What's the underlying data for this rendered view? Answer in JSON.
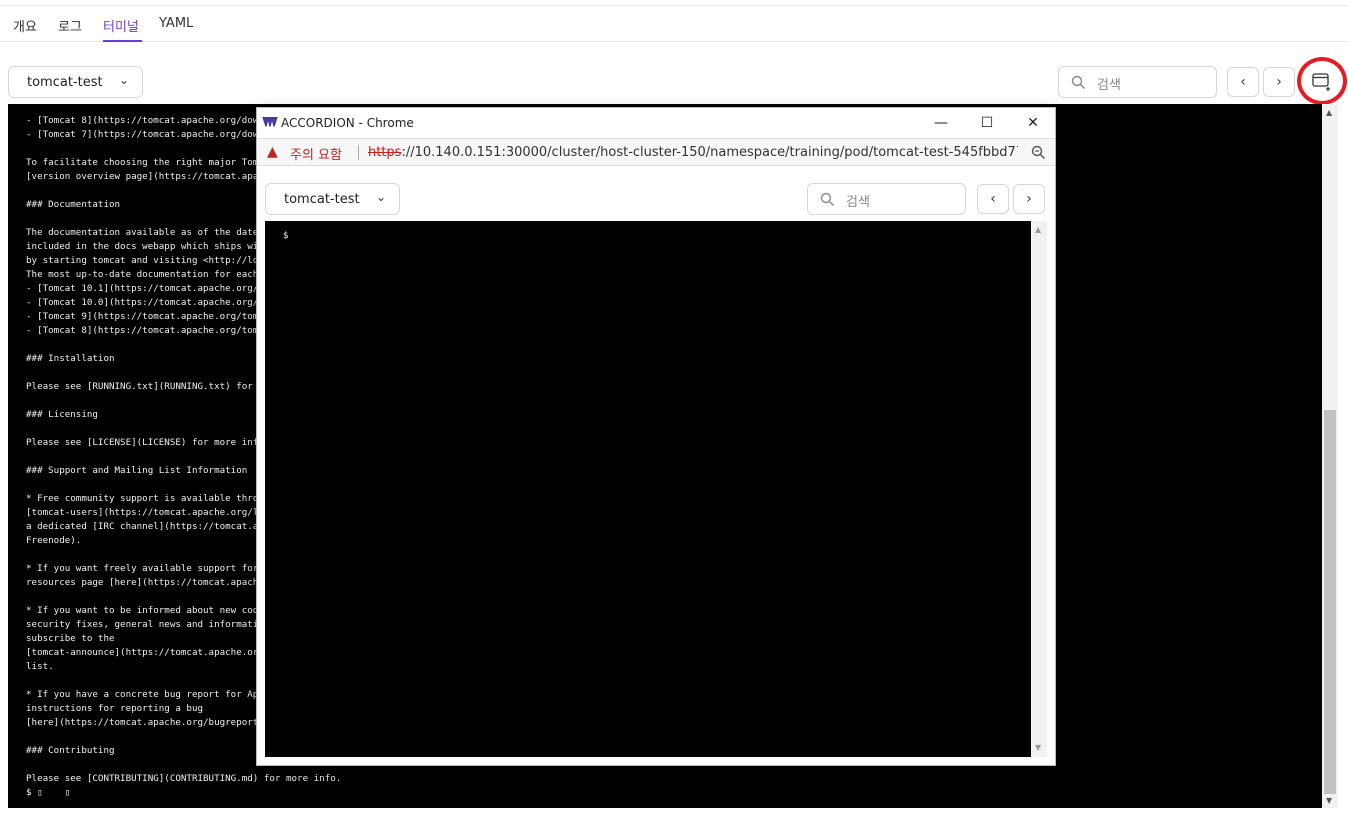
{
  "tabs": [
    {
      "label": "개요"
    },
    {
      "label": "로그"
    },
    {
      "label": "터미널"
    },
    {
      "label": "YAML"
    }
  ],
  "toolbar": {
    "container_select": "tomcat-test",
    "search_placeholder": "검색",
    "prev": "‹",
    "next": "›"
  },
  "terminal": {
    "lines": "- [Tomcat 8](https://tomcat.apache.org/downloa\n- [Tomcat 7](https://tomcat.apache.org/downloa\n\nTo facilitate choosing the right major Tomcat\n[version overview page](https://tomcat.apache.\n\n### Documentation\n\nThe documentation available as of the date of\nincluded in the docs webapp which ships with t\nby starting tomcat and visiting <http://localh\nThe most up-to-date documentation for each ver\n- [Tomcat 10.1](https://tomcat.apache.org/tomc\n- [Tomcat 10.0](https://tomcat.apache.org/tomc\n- [Tomcat 9](https://tomcat.apache.org/tomcat-\n- [Tomcat 8](https://tomcat.apache.org/tomcat-\n\n### Installation\n\nPlease see [RUNNING.txt](RUNNING.txt) for more\n\n### Licensing\n\nPlease see [LICENSE](LICENSE) for more info.\n\n### Support and Mailing List Information\n\n* Free community support is available through\n[tomcat-users](https://tomcat.apache.org/lists\na dedicated [IRC channel](https://tomcat.apach\nFreenode).\n\n* If you want freely available support for run\nresources page [here](https://tomcat.apache.or\n\n* If you want to be informed about new code re\nsecurity fixes, general news and information a\nsubscribe to the\n[tomcat-announce](https://tomcat.apache.org/li\nlist.\n\n* If you have a concrete bug report for Apache\ninstructions for reporting a bug\n[here](https://tomcat.apache.org/bugreport.htm\n\n### Contributing\n\nPlease see [CONTRIBUTING](CONTRIBUTING.md) for more info.\n$ ▯    ▯"
  },
  "popup": {
    "title": "ACCORDION - Chrome",
    "minimize": "—",
    "maximize": "☐",
    "close": "✕",
    "warning_label": "주의 요함",
    "url_scheme": "https",
    "url_rest": "://10.140.0.151:30000/cluster/host-cluster-150/namespace/training/pod/tomcat-test-545fbbd77...",
    "container_select": "tomcat-test",
    "search_placeholder": "검색",
    "prev": "‹",
    "next": "›",
    "prompt": "$"
  },
  "colors": {
    "accent": "#6b3fd4",
    "highlight_circle": "#e51c23",
    "warning": "#c5221f",
    "terminal_bg": "#000000"
  },
  "icons": [
    "search-icon",
    "chevron-down-icon",
    "new-window-icon",
    "warning-icon",
    "zoom-icon",
    "accordion-logo-icon"
  ]
}
